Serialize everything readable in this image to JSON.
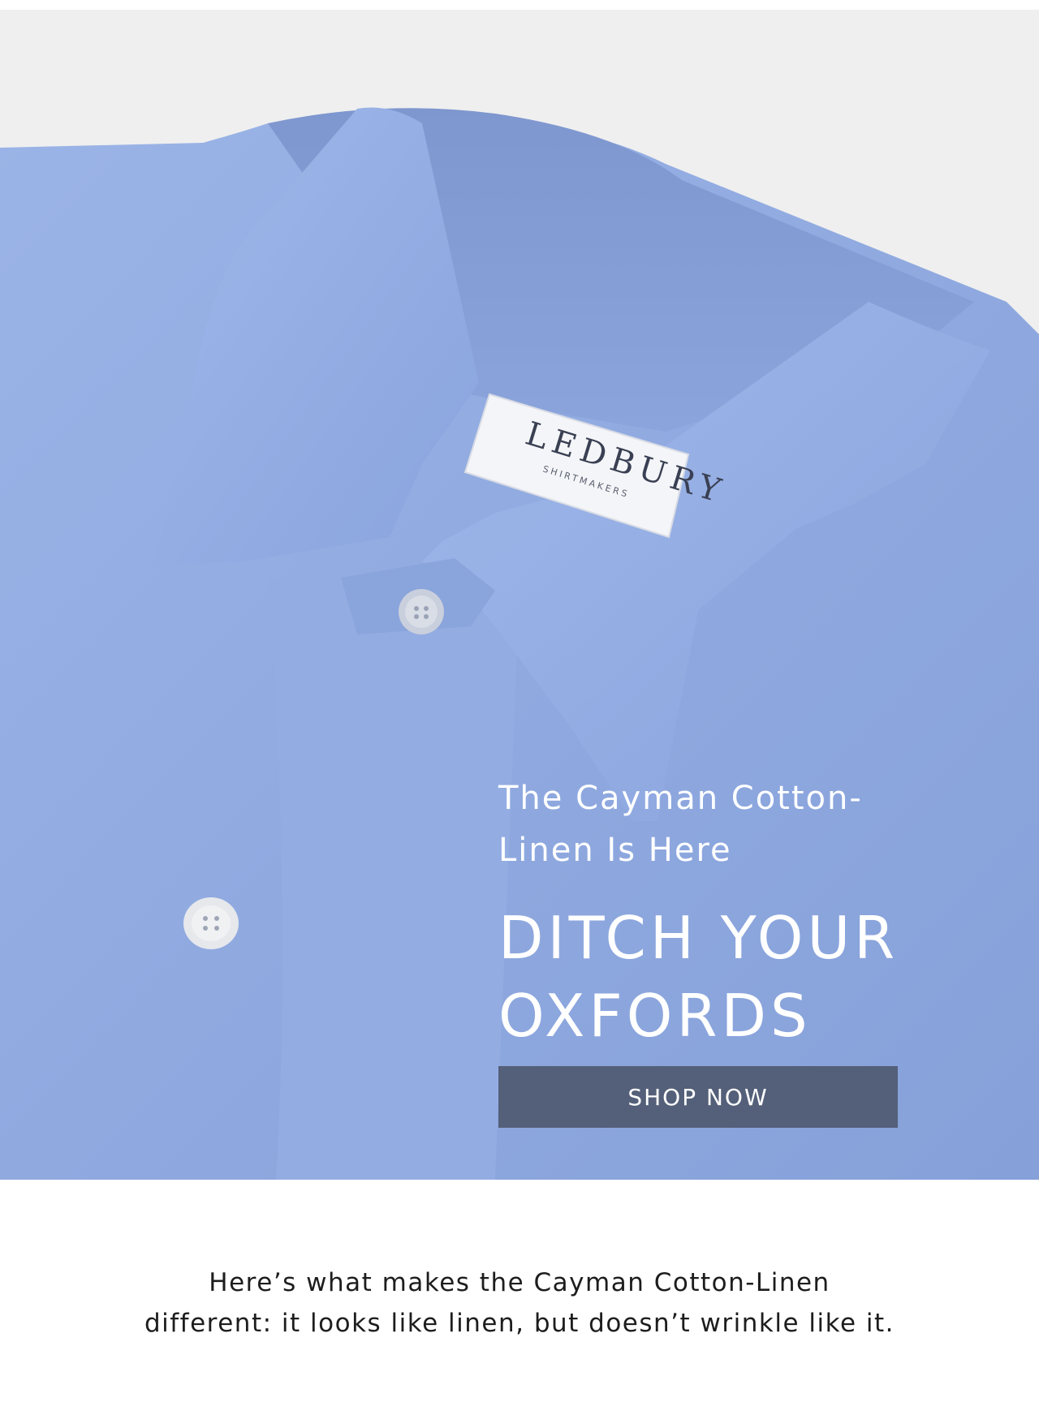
{
  "hero": {
    "label_brand": "LEDBURY",
    "label_sub": "SHIRTMAKERS",
    "eyebrow_line1": "The Cayman Cotton-",
    "eyebrow_line2": "Linen Is Here",
    "headline_line1": "DITCH YOUR",
    "headline_line2": "OXFORDS",
    "cta_label": "SHOP NOW"
  },
  "body": {
    "line1": "Here’s what makes the Cayman Cotton-Linen",
    "line2": "different: it looks like linen, but doesn’t wrinkle like it."
  },
  "colors": {
    "shirt": "#8fa9e0",
    "button": "#546079",
    "background": "#efefef"
  }
}
